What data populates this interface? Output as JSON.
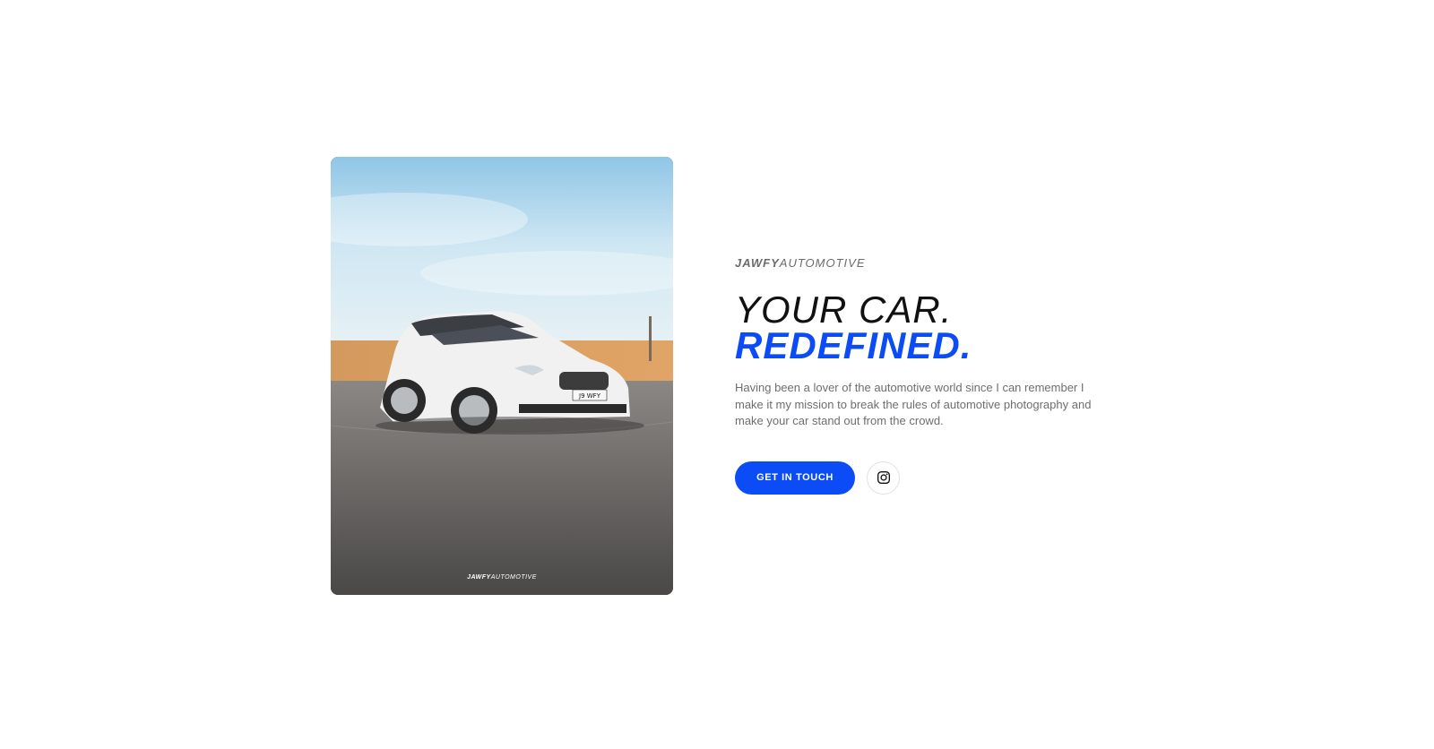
{
  "hero_photo": {
    "plate": "J9 WFY",
    "watermark_strong": "JAWFY",
    "watermark_light": "AUTOMOTIVE"
  },
  "brand": {
    "strong": "JAWFY",
    "light": "AUTOMOTIVE"
  },
  "headline": {
    "line1": "YOUR CAR.",
    "line2": "REDEFINED."
  },
  "description": "Having been a lover of the automotive world since I can remember I make it my mission to break the rules of automotive photography and make your car stand out from the crowd.",
  "actions": {
    "cta_label": "GET IN TOUCH",
    "social_icon": "instagram-icon"
  },
  "colors": {
    "accent": "#0b4cf6",
    "headline": "#111111",
    "body_text": "#6e6e6e",
    "background": "#ffffff"
  }
}
